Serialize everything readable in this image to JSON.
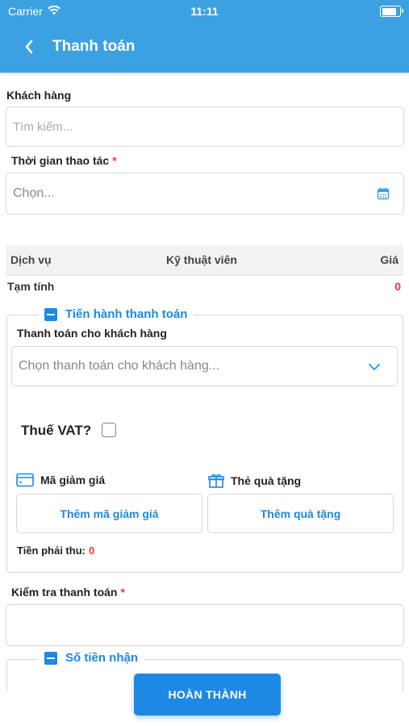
{
  "status_bar": {
    "carrier": "Carrier",
    "time": "11:11",
    "battery_level": 0.95
  },
  "nav": {
    "title": "Thanh toán"
  },
  "customer": {
    "label": "Khách hàng",
    "placeholder": "Tìm kiếm..."
  },
  "operation_time": {
    "label": "Thời gian thao tác",
    "required_mark": "*",
    "placeholder": "Chọn..."
  },
  "table": {
    "columns": [
      "Dịch vụ",
      "Kỹ thuật viên",
      "Giá"
    ]
  },
  "subtotal": {
    "label": "Tạm tính",
    "value": "0"
  },
  "payment_section": {
    "title": "Tiến hành thanh toán",
    "pay_for_customer_label": "Thanh toán cho khách hàng",
    "pay_select_placeholder": "Chọn thanh toán cho khách hàng...",
    "vat_label": "Thuế VAT?",
    "vat_checked": false,
    "discount_label": "Mã giảm giá",
    "gift_label": "Thẻ quà tặng",
    "add_discount_button": "Thêm mã giảm giá",
    "add_gift_button": "Thêm quà tặng",
    "amount_due_label": "Tiền phải thu:",
    "amount_due_value": "0"
  },
  "check_payment": {
    "label": "Kiểm tra thanh toán",
    "required_mark": "*"
  },
  "received_section": {
    "title": "Số tiền nhận"
  },
  "submit_button": "HOÀN THÀNH",
  "colors": {
    "primary": "#1e88e5",
    "header": "#3ba1e0",
    "danger": "#e53935"
  }
}
